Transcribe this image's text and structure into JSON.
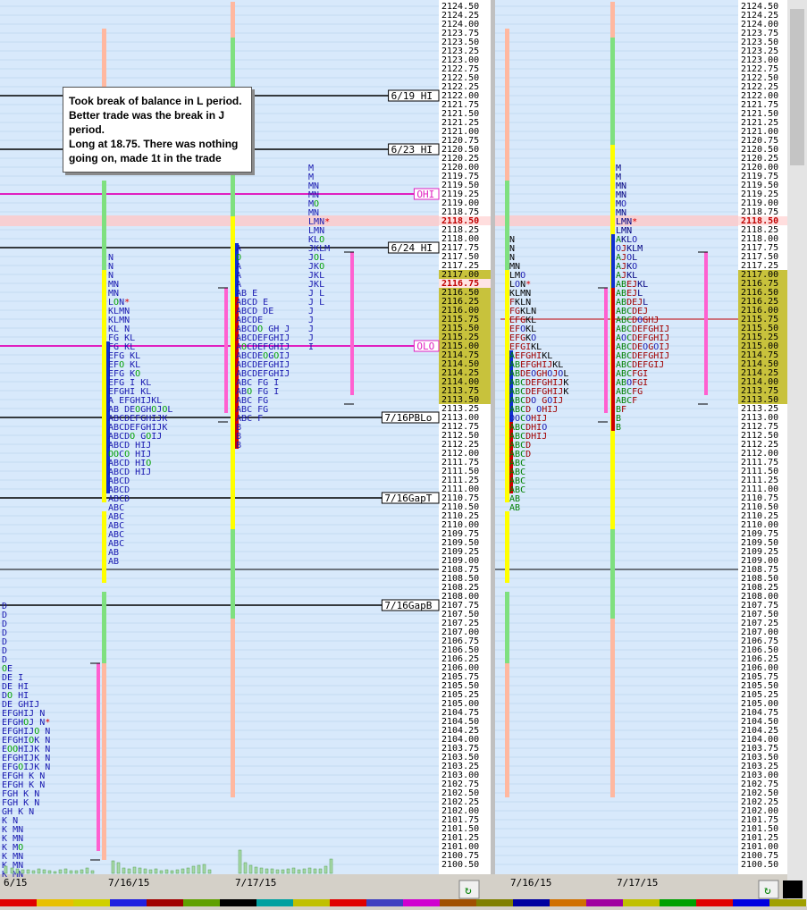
{
  "chart_data": [
    {
      "type": "market-profile",
      "panel": "left",
      "price_axis": {
        "min": 2100.5,
        "max": 2124.5,
        "step": 0.25
      },
      "x_dates": [
        "6/15",
        "7/16/15",
        "7/17/15"
      ],
      "current_price": "2118.50",
      "highlight_price": "2116.75",
      "reference_lines": [
        {
          "label": "6/19 HI",
          "price": 2122.0
        },
        {
          "label": "6/23 HI",
          "price": 2120.5
        },
        {
          "label": "OHI",
          "price": 2119.25
        },
        {
          "label": "6/24 HI",
          "price": 2117.75
        },
        {
          "label": "OLO",
          "price": 2115.0
        },
        {
          "label": "7/16PBLo",
          "price": 2113.0
        },
        {
          "label": "7/16GapT",
          "price": 2110.75
        },
        {
          "label": "7/16GapB",
          "price": 2107.75
        }
      ],
      "profiles": [
        {
          "date": "7/15",
          "top": 2107.75,
          "rows": [
            "D",
            "D",
            "D",
            "D",
            "D",
            "D",
            "D",
            "OE",
            "DE   I",
            "DE  HI",
            "DO  HI",
            "DE GHIJ",
            "EFGHIJ   N",
            "EFGHOJ   N*",
            "EFGHIJO  N",
            "EFGHIOK  N",
            "EOOHIJK  N",
            "EFGHIJK  N",
            "EFGOIJK  N",
            "EFGH  K  N",
            "EFGH  K  N",
            "FGH  K  N",
            "FGH  K  N",
            "GH  K  N",
            "    K  N",
            "    K MN",
            "    K MN",
            "    K MO",
            "    K MN",
            "    K MN",
            "    K MN"
          ]
        },
        {
          "date": "7/16/15",
          "top": 2117.5,
          "rows": [
            "N",
            "N",
            "N",
            "MN",
            "MN",
            "LON*",
            "KLMN",
            "KLMN",
            "KL N",
            "FG     KL",
            "FG     KL",
            "EFG    KL",
            "EFO    KL",
            "EFG    KO",
            "EFG I  KL",
            "EFGHI  KL",
            "A  EFGHIJKL",
            "AB DEOGHOJOL",
            "ABCDEFGHIJK",
            "ABCDEFGHIJK",
            "ABCDO  GOIJ",
            "ABCD    HIJ",
            "OOCO    HIJ",
            "ABCD    HIO",
            "ABCD    HIJ",
            "ABCD",
            "ABCD",
            "ABCD",
            "ABC",
            "ABC",
            "ABC",
            "ABC",
            "ABC",
            "AB",
            "AB"
          ]
        },
        {
          "date": "7/17/15",
          "top": 2117.75,
          "rows": [
            "A",
            "O",
            "A",
            "A",
            "A",
            "AB   E",
            "ABCD  E",
            "ABCD  DE",
            "ABCDE",
            "ABCDO  GH J",
            "ABCDEFGHIJ",
            "AOCDEFGHIJ",
            "ABCDEOGOIJ",
            "ABCDEFGHIJ",
            "ABCDEFGHIJ",
            "ABC  FG I",
            "ABO  FG I",
            "ABC  FG",
            "ABC  FG",
            "ABC  F",
            "B",
            "B",
            "B"
          ]
        },
        {
          "date": "7/17/15",
          "top": 2120.0,
          "rows": [
            "M",
            "M",
            "MN",
            "MN",
            "MO",
            "MN",
            "LMN*",
            "LMN",
            "KLO",
            "JKLM",
            "JOL",
            "JKO",
            "JKL",
            "JKL",
            "J L",
            "J L",
            "J",
            "J",
            "J",
            "J",
            "I"
          ]
        }
      ]
    },
    {
      "type": "market-profile",
      "panel": "right",
      "price_axis": {
        "min": 2100.5,
        "max": 2124.5,
        "step": 0.25
      },
      "x_dates": [
        "7/16/15",
        "7/17/15"
      ],
      "current_price": "2118.50",
      "profiles": [
        {
          "date": "7/16/15",
          "top": 2118.0,
          "rows": [
            "N",
            "N",
            "N",
            "MN",
            "LMO",
            "LON*",
            "KLMN",
            "FKLN",
            "FGKLN",
            "EFGKL",
            "EFOKL",
            "EFGKO",
            "EFGIKL",
            "AEFGHIKL",
            "ABEFGHIJKL",
            "ABDEOGHOJOL",
            "ABCDEFGHIJK",
            "ABCDEFGHIJK",
            "ABCDO GOIJ",
            "ABCD OHIJ",
            "OOCOHIJ",
            "ABCDHIO",
            "ABCDHIJ",
            "ABCD",
            "ABCD",
            "ABC",
            "ABC",
            "ABC",
            "ABC",
            "AB",
            "AB"
          ]
        },
        {
          "date": "7/17/15",
          "top": 2120.0,
          "rows": [
            "M",
            "M",
            "MN",
            "MN",
            "MO",
            "MN",
            "LMN*",
            "LMN",
            "AKLO",
            "OJKLM",
            "AJOL",
            "AJKO",
            "AJKL",
            "ABEJKL",
            "ABEJL",
            "ABDEJL",
            "ABCDEJ",
            "ABCDOGHJ",
            "ABCDEFGHIJ",
            "AOCDEFGHIJ",
            "ABCDEOGOIJ",
            "ABCDEFGHIJ",
            "ABCDEFGIJ",
            "ABCFGI",
            "ABOFGI",
            "ABCFG",
            "ABCF",
            "BF",
            "B",
            "B"
          ]
        }
      ]
    }
  ],
  "annotation": {
    "lines": [
      "Took break of balance in L period.",
      "Better trade was the break in J",
      "period.",
      "Long at 18.75. There was nothing",
      "going on, made 1t in the trade"
    ]
  }
}
